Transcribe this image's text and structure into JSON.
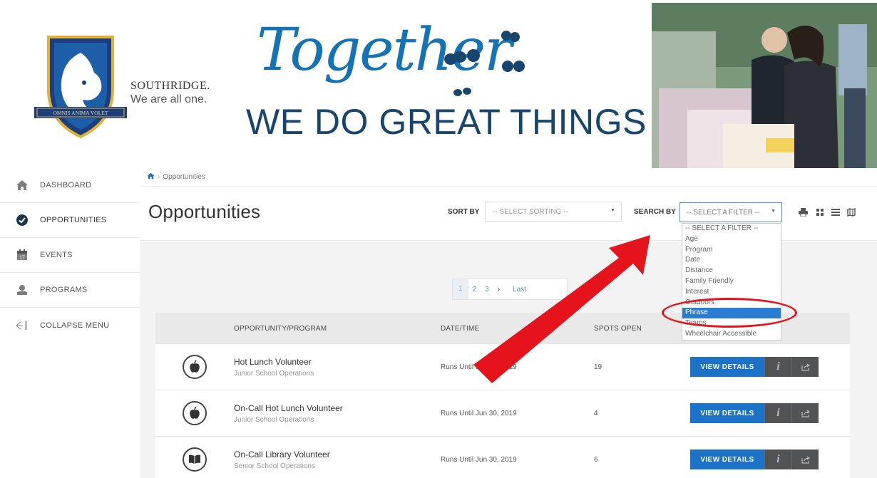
{
  "banner": {
    "brand_name": "SOUTHRIDGE.",
    "brand_tagline": "We are all one.",
    "crest_motto": "OMNIS ANIMA VOLET",
    "headline_script": "Together",
    "headline_main": "WE DO GREAT THINGS"
  },
  "sidebar": {
    "items": [
      {
        "label": "DASHBOARD",
        "icon": "home-icon"
      },
      {
        "label": "OPPORTUNITIES",
        "icon": "check-circle-icon"
      },
      {
        "label": "EVENTS",
        "icon": "calendar-icon"
      },
      {
        "label": "PROGRAMS",
        "icon": "hand-heart-icon"
      },
      {
        "label": "COLLAPSE MENU",
        "icon": "collapse-icon"
      }
    ]
  },
  "breadcrumb": {
    "current": "Opportunities"
  },
  "header": {
    "title": "Opportunities",
    "sort_label": "SORT BY",
    "sort_value": "-- SELECT SORTING --",
    "search_label": "SEARCH BY",
    "filter_value": "-- SELECT A FILTER --"
  },
  "filter_options": [
    "-- SELECT A FILTER --",
    "Age",
    "Program",
    "Date",
    "Distance",
    "Family Friendly",
    "Interest",
    "Outdoors",
    "Phrase",
    "Teams",
    "Wheelchair Accessible"
  ],
  "filter_selected": "Phrase",
  "pagination": {
    "pages": [
      "1",
      "2",
      "3"
    ],
    "next": "›",
    "last": "Last",
    "current": "1"
  },
  "table": {
    "headers": {
      "name": "OPPORTUNITY/PROGRAM",
      "date": "DATE/TIME",
      "spots": "SPOTS OPEN"
    },
    "rows": [
      {
        "icon": "apple-icon",
        "title": "Hot Lunch Volunteer",
        "sub": "Junior School Operations",
        "date": "Runs Until Jun 30, 2019",
        "spots": "19"
      },
      {
        "icon": "apple-icon",
        "title": "On-Call Hot Lunch Volunteer",
        "sub": "Junior School Operations",
        "date": "Runs Until Jun 30, 2019",
        "spots": "4"
      },
      {
        "icon": "book-icon",
        "title": "On-Call Library Volunteer",
        "sub": "Senior School Operations",
        "date": "Runs Until Jun 30, 2019",
        "spots": "6"
      }
    ],
    "view_label": "VIEW DETAILS",
    "info_label": "i"
  },
  "colors": {
    "primary_blue": "#1b72c6",
    "annotation_red": "#e5141c",
    "headline_blue": "#1573b5",
    "headline_navy": "#17456e"
  }
}
